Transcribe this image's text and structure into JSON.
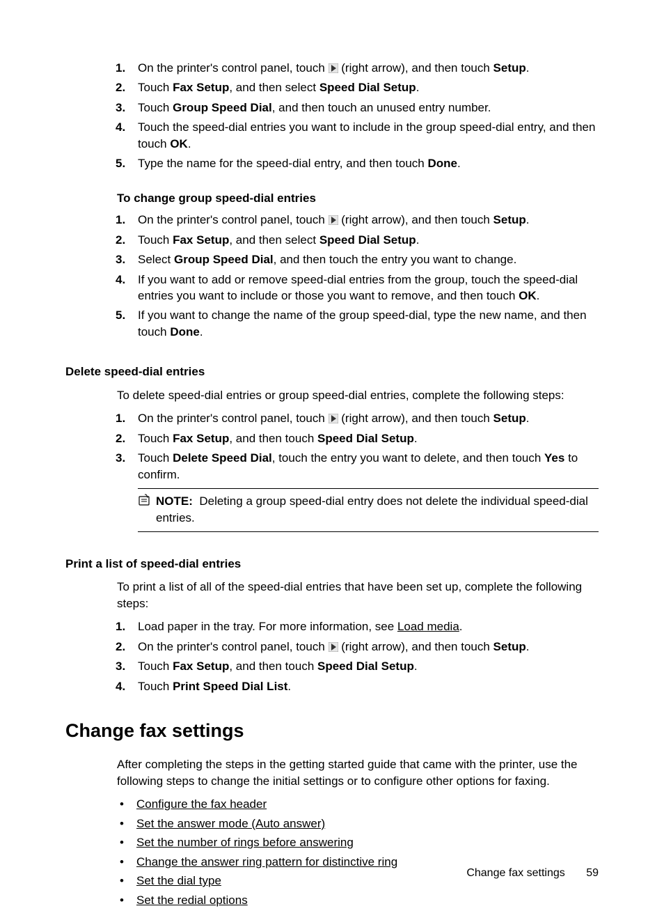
{
  "section_a": {
    "items": [
      {
        "num": "1.",
        "pre": "On the printer's control panel, touch ",
        "arrow_label": "(right arrow)",
        "mid": ", and then touch ",
        "bold": "Setup",
        "post": "."
      },
      {
        "num": "2.",
        "pre": "Touch ",
        "bold1": "Fax Setup",
        "mid": ", and then select ",
        "bold2": "Speed Dial Setup",
        "post": "."
      },
      {
        "num": "3.",
        "pre": "Touch ",
        "bold1": "Group Speed Dial",
        "mid": ", and then touch an unused entry number."
      },
      {
        "num": "4.",
        "pre": "Touch the speed-dial entries you want to include in the group speed-dial entry, and then touch ",
        "bold1": "OK",
        "post": "."
      },
      {
        "num": "5.",
        "pre": "Type the name for the speed-dial entry, and then touch ",
        "bold1": "Done",
        "post": "."
      }
    ]
  },
  "change_group": {
    "heading": "To change group speed-dial entries",
    "items": [
      {
        "num": "1.",
        "pre": "On the printer's control panel, touch ",
        "arrow_label": "(right arrow)",
        "mid": ", and then touch ",
        "bold": "Setup",
        "post": "."
      },
      {
        "num": "2.",
        "pre": "Touch ",
        "bold1": "Fax Setup",
        "mid": ", and then select ",
        "bold2": "Speed Dial Setup",
        "post": "."
      },
      {
        "num": "3.",
        "pre": "Select ",
        "bold1": "Group Speed Dial",
        "mid": ", and then touch the entry you want to change."
      },
      {
        "num": "4.",
        "pre": "If you want to add or remove speed-dial entries from the group, touch the speed-dial entries you want to include or those you want to remove, and then touch ",
        "bold1": "OK",
        "post": "."
      },
      {
        "num": "5.",
        "pre": "If you want to change the name of the group speed-dial, type the new name, and then touch ",
        "bold1": "Done",
        "post": "."
      }
    ]
  },
  "delete": {
    "heading": "Delete speed-dial entries",
    "intro": "To delete speed-dial entries or group speed-dial entries, complete the following steps:",
    "items": [
      {
        "num": "1.",
        "pre": "On the printer's control panel, touch ",
        "arrow_label": "(right arrow)",
        "mid": ", and then touch ",
        "bold": "Setup",
        "post": "."
      },
      {
        "num": "2.",
        "pre": "Touch ",
        "bold1": "Fax Setup",
        "mid": ", and then touch ",
        "bold2": "Speed Dial Setup",
        "post": "."
      },
      {
        "num": "3.",
        "pre": "Touch ",
        "bold1": "Delete Speed Dial",
        "mid": ", touch the entry you want to delete, and then touch ",
        "bold2": "Yes",
        "post": " to confirm."
      }
    ],
    "note_label": "NOTE:",
    "note_text": "Deleting a group speed-dial entry does not delete the individual speed-dial entries."
  },
  "print_list": {
    "heading": "Print a list of speed-dial entries",
    "intro": "To print a list of all of the speed-dial entries that have been set up, complete the following steps:",
    "items": [
      {
        "num": "1.",
        "pre": "Load paper in the tray. For more information, see ",
        "link": "Load media",
        "post": "."
      },
      {
        "num": "2.",
        "pre": "On the printer's control panel, touch ",
        "arrow_label": "(right arrow)",
        "mid": ", and then touch ",
        "bold": "Setup",
        "post": "."
      },
      {
        "num": "3.",
        "pre": "Touch ",
        "bold1": "Fax Setup",
        "mid": ", and then touch ",
        "bold2": "Speed Dial Setup",
        "post": "."
      },
      {
        "num": "4.",
        "pre": "Touch ",
        "bold1": "Print Speed Dial List",
        "post": "."
      }
    ]
  },
  "change_fax": {
    "heading": "Change fax settings",
    "intro": "After completing the steps in the getting started guide that came with the printer, use the following steps to change the initial settings or to configure other options for faxing.",
    "links": [
      "Configure the fax header",
      "Set the answer mode (Auto answer)",
      "Set the number of rings before answering",
      "Change the answer ring pattern for distinctive ring",
      "Set the dial type",
      "Set the redial options"
    ]
  },
  "footer": {
    "title": "Change fax settings",
    "page": "59"
  }
}
